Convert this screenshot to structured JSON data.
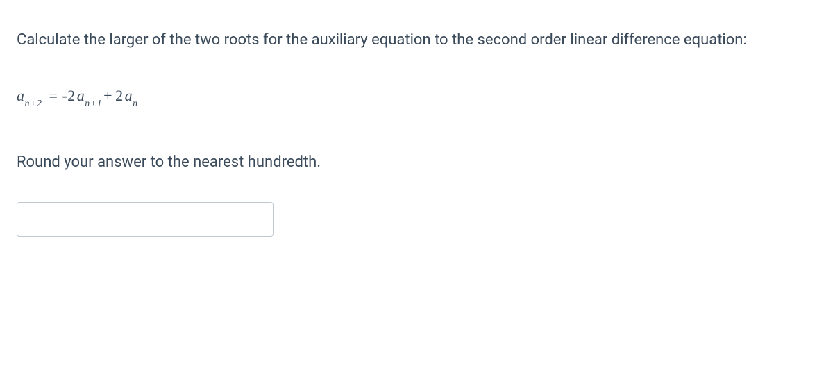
{
  "question": {
    "prompt": "Calculate the larger of the two roots for the auxiliary equation to the second order linear difference equation:",
    "equation": {
      "lhs_var": "a",
      "lhs_sub": "n+2",
      "eq": "=",
      "t1_coef": "-2",
      "t1_var": "a",
      "t1_sub": "n+1",
      "plus": "+",
      "t2_coef": "2",
      "t2_var": "a",
      "t2_sub": "n"
    },
    "instruction": "Round your answer to the nearest hundredth.",
    "answer_value": ""
  }
}
